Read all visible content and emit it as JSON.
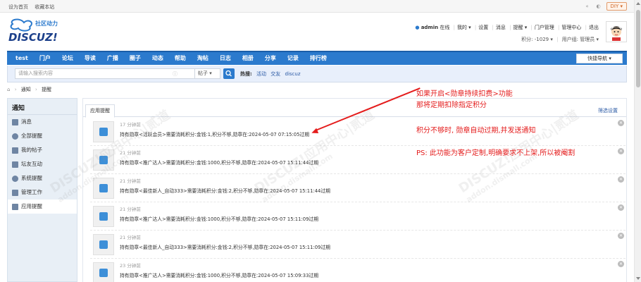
{
  "topbar": {
    "links": [
      "设为首页",
      "收藏本站"
    ],
    "diy_label": "DIY ▾"
  },
  "logo": {
    "text": "DISCUZ!",
    "subtitle": "社区动力"
  },
  "user": {
    "name": "admin",
    "status": "在线",
    "links": [
      "我的 ▾",
      "设置",
      "消息",
      "提醒 ▾",
      "门户管理",
      "管理中心",
      "退出"
    ],
    "credits_label": "积分: -1029 ▾",
    "group_label": "用户组: 管理员 ▾"
  },
  "nav": {
    "items": [
      "test",
      "门户",
      "论坛",
      "导读",
      "广播",
      "圈子",
      "动态",
      "帮助",
      "淘帖",
      "日志",
      "相册",
      "分享",
      "记录",
      "排行榜"
    ],
    "quick_nav": "快捷导航 ▾"
  },
  "search": {
    "placeholder": "请输入搜索内容",
    "type": "帖子 ▾",
    "hot_label": "热搜:",
    "hot_terms": [
      "活动",
      "交友",
      "discuz"
    ]
  },
  "breadcrumb": [
    "⌂",
    "›",
    "通知",
    "›",
    "提醒"
  ],
  "sidebar": {
    "title": "通知",
    "items": [
      {
        "label": "消息",
        "icon": "mail-icon"
      },
      {
        "label": "全部提醒",
        "icon": "user-icon"
      },
      {
        "label": "我的帖子",
        "icon": "post-icon"
      },
      {
        "label": "坛友互动",
        "icon": "interact-icon"
      },
      {
        "label": "系统提醒",
        "icon": "gear-icon"
      },
      {
        "label": "管理工作",
        "icon": "link-icon"
      },
      {
        "label": "应用提醒",
        "icon": "app-icon"
      }
    ]
  },
  "main": {
    "tab": "应用提醒",
    "filter": "筛选设置",
    "notices": [
      {
        "time": "17 分钟前",
        "text": "持有勋章<活跃会员>需要消耗积分:金钱:1,积分不够,勋章在:2024-05-07 07:15:05过期"
      },
      {
        "time": "21 分钟前",
        "text": "持有勋章<推广达人>需要消耗积分:金钱:1000,积分不够,勋章在:2024-05-07 15:11:44过期"
      },
      {
        "time": "21 分钟前",
        "text": "持有勋章<最佳新人_自动333>需要消耗积分:金钱:2,积分不够,勋章在:2024-05-07 15:11:44过期"
      },
      {
        "time": "21 分钟前",
        "text": "持有勋章<推广达人>需要消耗积分:金钱:1000,积分不够,勋章在:2024-05-07 15:11:09过期"
      },
      {
        "time": "21 分钟前",
        "text": "持有勋章<最佳新人_自动333>需要消耗积分:金钱:2,积分不够,勋章在:2024-05-07 15:11:09过期"
      },
      {
        "time": "23 分钟前",
        "text": "持有勋章<推广达人>需要消耗积分:金钱:1000,积分不够,勋章在:2024-05-07 15:09:33过期"
      }
    ]
  },
  "annotations": {
    "line1": "如果开启<勋章持续扣费>功能",
    "line2": "那将定期扣除指定积分",
    "line3": "积分不够时, 勋章自动过期,并发送通知",
    "line4": "PS: 此功能为客户定制,明确要求不上架,所以被阉割"
  },
  "watermark": {
    "text": "DISCUZ!应用中心|贰道",
    "sub": "addon.dismall.com"
  },
  "colors": {
    "nav_bg": "#2b7acd",
    "annotation": "#e41c1c",
    "sidebar_bg": "#e8eff6"
  }
}
